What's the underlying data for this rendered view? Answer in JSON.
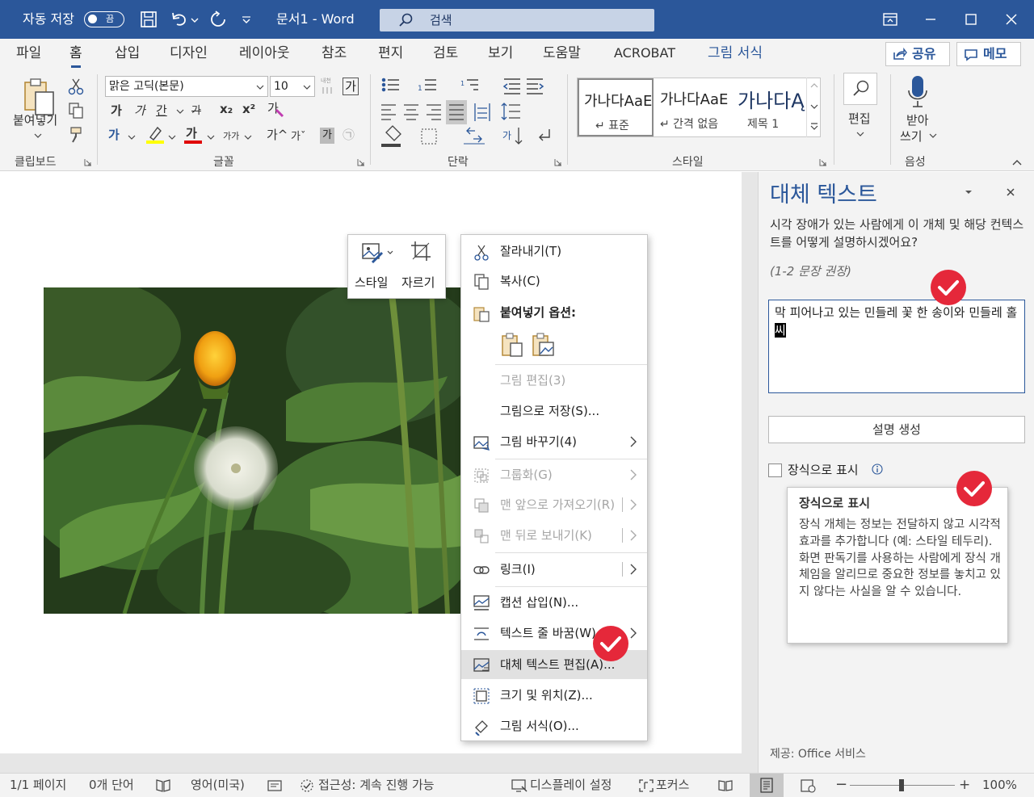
{
  "titlebar": {
    "autosave_label": "자동 저장",
    "autosave_state": "끔",
    "doc_title": "문서1  -  Word",
    "search_placeholder": "검색"
  },
  "tabs": [
    {
      "label": "파일"
    },
    {
      "label": "홈"
    },
    {
      "label": "삽입"
    },
    {
      "label": "디자인"
    },
    {
      "label": "레이아웃"
    },
    {
      "label": "참조"
    },
    {
      "label": "편지"
    },
    {
      "label": "검토"
    },
    {
      "label": "보기"
    },
    {
      "label": "도움말"
    },
    {
      "label": "ACROBAT"
    },
    {
      "label": "그림 서식"
    }
  ],
  "share_label": "공유",
  "memo_label": "메모",
  "ribbon": {
    "clipboard": {
      "paste_label": "붙여넣기",
      "group": "클립보드"
    },
    "font": {
      "font_name": "맑은 고딕(본문)",
      "font_size": "10",
      "group": "글꼴",
      "bold": "가",
      "italic": "가",
      "underline": "간",
      "strike": "가",
      "sub": "x₂",
      "sup": "x²",
      "highlight": "가",
      "color": "가",
      "size_small": "가가",
      "grow": "가^",
      "shrink": "가ˇ",
      "charbox": "가",
      "circle": "㉠"
    },
    "paragraph": {
      "group": "단락"
    },
    "styles": {
      "group": "스타일",
      "items": [
        {
          "preview": "가나다AaE",
          "name": "↵ 표준"
        },
        {
          "preview": "가나다AaE",
          "name": "↵ 간격 없음"
        },
        {
          "preview": "가나다Ą",
          "name": "제목 1"
        }
      ]
    },
    "editing": {
      "label": "편집"
    },
    "voice": {
      "label1": "받아",
      "label2": "쓰기",
      "group": "음성"
    }
  },
  "minitoolbar": {
    "style_label": "스타일",
    "crop_label": "자르기"
  },
  "context_menu": {
    "cut": "잘라내기(T)",
    "copy": "복사(C)",
    "paste_options": "붙여넣기 옵션:",
    "edit_picture": "그림 편집(3)",
    "save_as_picture": "그림으로 저장(S)...",
    "change_picture": "그림 바꾸기(4)",
    "group": "그룹화(G)",
    "bring_front": "맨 앞으로 가져오기(R)",
    "send_back": "맨 뒤로 보내기(K)",
    "link": "링크(I)",
    "insert_caption": "캡션 삽입(N)...",
    "wrap_text": "텍스트 줄 바꿈(W)",
    "edit_alt_text": "대체 텍스트 편집(A)...",
    "size_position": "크기 및 위치(Z)...",
    "format_picture": "그림 서식(O)..."
  },
  "pane": {
    "title": "대체 텍스트",
    "description": "시각 장애가 있는 사람에게 이 개체 및 해당 컨텍스트를 어떻게 설명하시겠어요?",
    "hint": "(1-2 문장 권장)",
    "alt_text": "막 피어나고 있는 민들레 꽃 한 송이와 민들레 홀",
    "alt_text_selected": "씨",
    "generate_button": "설명 생성",
    "decorative_label": "장식으로 표시",
    "tooltip_title": "장식으로 표시",
    "tooltip_body": "장식 개체는 정보는 전달하지 않고 시각적 효과를 추가합니다 (예: 스타일 테두리). 화면 판독기를 사용하는 사람에게 장식 개체임을 알리므로 중요한 정보를 놓치고 있지 않다는 사실을 알 수 있습니다.",
    "provider": "제공: Office 서비스"
  },
  "status": {
    "page": "1/1 페이지",
    "words": "0개 단어",
    "language": "영어(미국)",
    "accessibility": "접근성: 계속 진행 가능",
    "display_settings": "디스플레이 설정",
    "focus": "포커스",
    "zoom": "100%",
    "zoom_level": 1.0
  },
  "colors": {
    "accent": "#2b579a",
    "badge": "#e5283a",
    "ribbon_bg": "#f3f3f3"
  }
}
